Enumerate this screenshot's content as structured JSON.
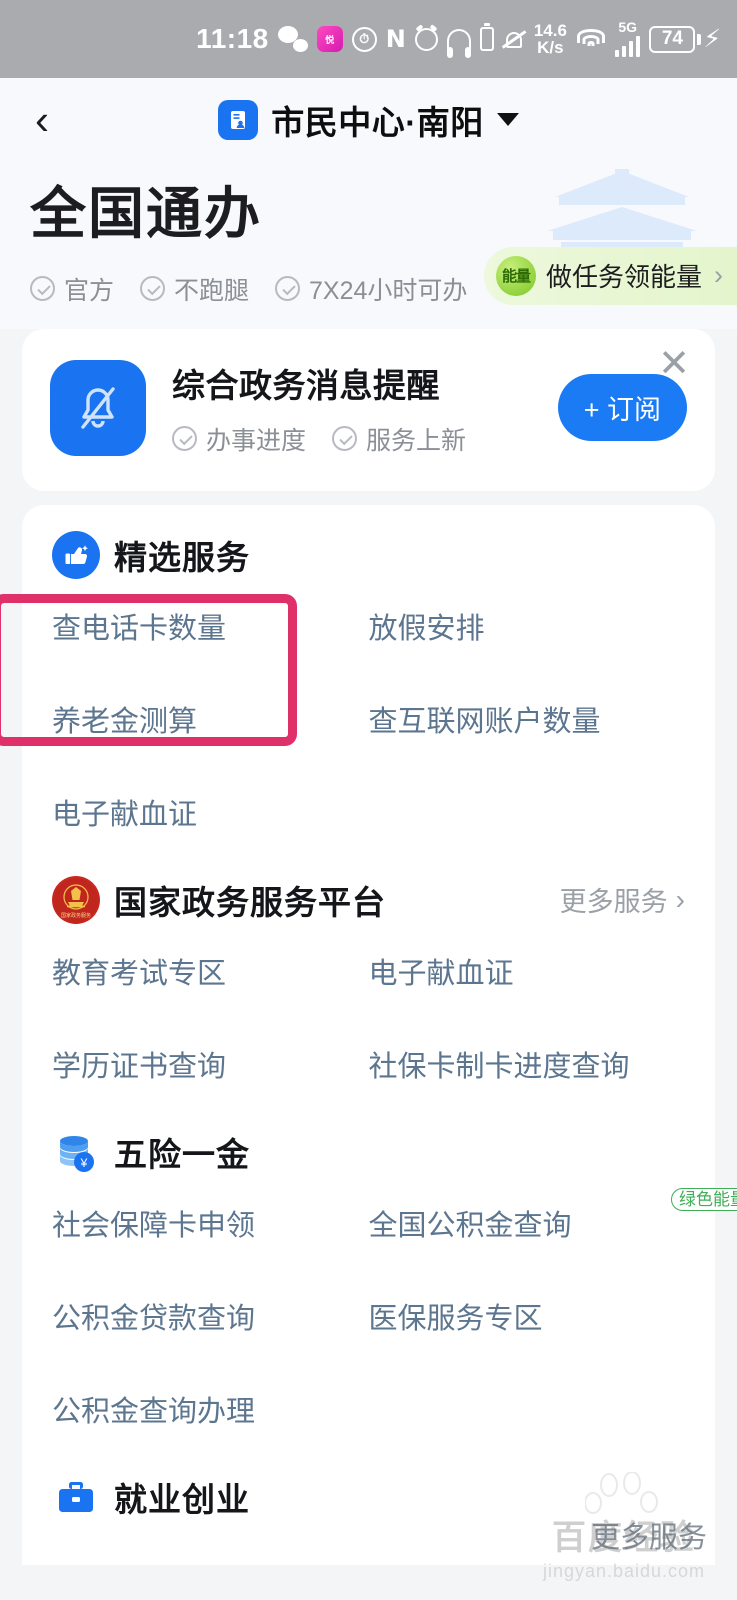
{
  "statusbar": {
    "time": "11:18",
    "wechat_icon": "wechat-icon",
    "app_icon_label": "悦",
    "nfc_label": "N",
    "network_speed_value": "14.6",
    "network_speed_unit": "K/s",
    "network_type": "5G",
    "battery_percent": "74",
    "charging_icon": "lightning-bolt-icon"
  },
  "navbar": {
    "back_icon": "back-chevron-icon",
    "app_icon": "citizen-center-app-icon",
    "title": "市民中心·南阳",
    "dropdown_icon": "chevron-down-icon"
  },
  "hero": {
    "title": "全国通办",
    "tags": [
      "官方",
      "不跑腿",
      "7X24小时可办"
    ],
    "temple_icon": "temple-illustration",
    "energy": {
      "ball_label": "能量",
      "text": "做任务领能量",
      "arrow": "›"
    }
  },
  "subscribe_card": {
    "icon": "bell-icon",
    "title": "综合政务消息提醒",
    "tags": [
      "办事进度",
      "服务上新"
    ],
    "button_label": "+ 订阅",
    "close_icon": "close-icon"
  },
  "sections": [
    {
      "icon": "thumbs-up-icon",
      "title": "精选服务",
      "more_label": "",
      "links": [
        "查电话卡数量",
        "放假安排",
        "养老金测算",
        "查互联网账户数量",
        "电子献血证"
      ]
    },
    {
      "icon": "national-emblem-icon",
      "title": "国家政务服务平台",
      "more_label": "更多服务",
      "links": [
        "教育考试专区",
        "电子献血证",
        "学历证书查询",
        "社保卡制卡进度查询"
      ]
    },
    {
      "icon": "coins-icon",
      "title": "五险一金",
      "more_label": "",
      "links": [
        "社会保障卡申领",
        "全国公积金查询",
        "公积金贷款查询",
        "医保服务专区",
        "公积金查询办理"
      ],
      "badges": {
        "全国公积金查询": "绿色能量"
      }
    },
    {
      "icon": "briefcase-icon",
      "title": "就业创业",
      "more_label": "",
      "links": []
    }
  ],
  "footer": {
    "more_services_label": "更多服务",
    "watermark_title": "百度经验",
    "watermark_url": "jingyan.baidu.com"
  },
  "annotation": {
    "highlight_color": "#e0306a",
    "highlight_target": "查电话卡数量"
  },
  "colors": {
    "accent_blue": "#1a73f0",
    "link_blue": "#5d768f",
    "green": "#3fae56",
    "highlight": "#e0306a"
  }
}
